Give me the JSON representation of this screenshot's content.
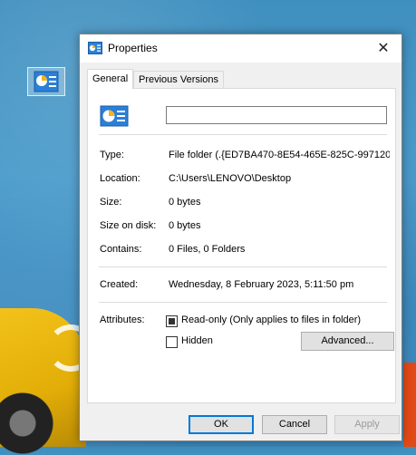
{
  "window": {
    "title": "Properties",
    "close_glyph": "✕"
  },
  "tabs": [
    {
      "label": "General",
      "active": true
    },
    {
      "label": "Previous Versions",
      "active": false
    }
  ],
  "general": {
    "name_value": "",
    "rows": {
      "type": {
        "label": "Type:",
        "value": "File folder (.{ED7BA470-8E54-465E-825C-9971204"
      },
      "location": {
        "label": "Location:",
        "value": "C:\\Users\\LENOVO\\Desktop"
      },
      "size": {
        "label": "Size:",
        "value": "0 bytes"
      },
      "size_on_disk": {
        "label": "Size on disk:",
        "value": "0 bytes"
      },
      "contains": {
        "label": "Contains:",
        "value": "0 Files, 0 Folders"
      },
      "created": {
        "label": "Created:",
        "value": "Wednesday, 8 February 2023, 5:11:50 pm"
      }
    },
    "attributes": {
      "label": "Attributes:",
      "readonly": {
        "label": "Read-only (Only applies to files in folder)",
        "state": "indeterminate"
      },
      "hidden": {
        "label": "Hidden",
        "state": "unchecked"
      },
      "advanced_label": "Advanced..."
    }
  },
  "buttons": {
    "ok": "OK",
    "cancel": "Cancel",
    "apply": "Apply"
  },
  "colors": {
    "accent": "#0078d7",
    "icon_blue": "#2b7fd6"
  },
  "icons": {
    "folder": "control-panel-folder-icon"
  }
}
